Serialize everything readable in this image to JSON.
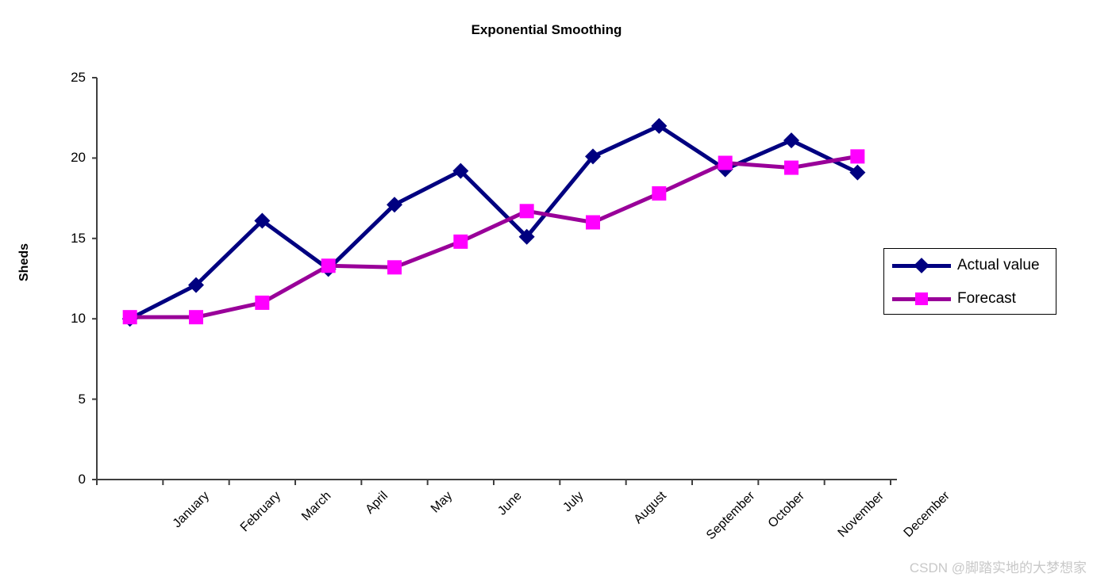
{
  "watermark": "CSDN @脚踏实地的大梦想家",
  "legend": {
    "position": "right-middle",
    "entries": [
      {
        "label": "Actual value",
        "marker": "diamond",
        "line_color": "#000080",
        "marker_color": "#000080"
      },
      {
        "label": "Forecast",
        "marker": "square",
        "line_color": "#990099",
        "marker_color": "#FF00FF"
      }
    ]
  },
  "chart_data": {
    "type": "line",
    "title": "Exponential Smoothing",
    "xlabel": "",
    "ylabel": "Sheds",
    "categories": [
      "January",
      "February",
      "March",
      "April",
      "May",
      "June",
      "July",
      "August",
      "September",
      "October",
      "November",
      "December"
    ],
    "series": [
      {
        "name": "Actual value",
        "color": "#000080",
        "marker": "diamond",
        "values": [
          10.0,
          12.1,
          16.1,
          13.1,
          17.1,
          19.2,
          15.1,
          20.1,
          22.0,
          19.3,
          21.1,
          19.1
        ]
      },
      {
        "name": "Forecast",
        "color": "#990099",
        "marker_color": "#FF00FF",
        "marker": "square",
        "values": [
          10.1,
          10.1,
          11.0,
          13.3,
          13.2,
          14.8,
          16.7,
          16.0,
          17.8,
          19.7,
          19.4,
          20.1
        ]
      }
    ],
    "ylim": [
      0,
      25
    ],
    "yticks": [
      0,
      5,
      10,
      15,
      20,
      25
    ],
    "ytick_labels": [
      "0",
      "5",
      "10",
      "15",
      "20",
      "25"
    ],
    "grid": false,
    "xtick_rotation": -45
  }
}
